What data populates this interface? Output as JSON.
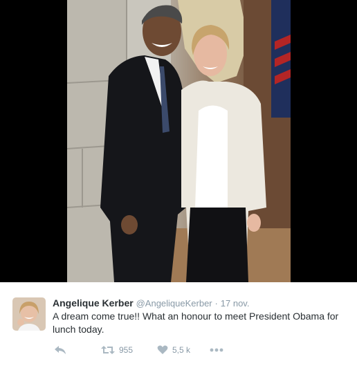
{
  "tweet": {
    "author_name": "Angelique Kerber",
    "handle": "@AngeliqueKerber",
    "separator": "·",
    "date": "17 nov.",
    "text": "A dream come true!! What an honour to meet President Obama for lunch today.",
    "retweet_count": "955",
    "like_count": "5,5 k",
    "colors": {
      "name": "#292f33",
      "meta": "#8899a6",
      "icons": "#aab8c2"
    }
  },
  "icons": [
    "reply-icon",
    "retweet-icon",
    "like-icon",
    "more-icon"
  ]
}
